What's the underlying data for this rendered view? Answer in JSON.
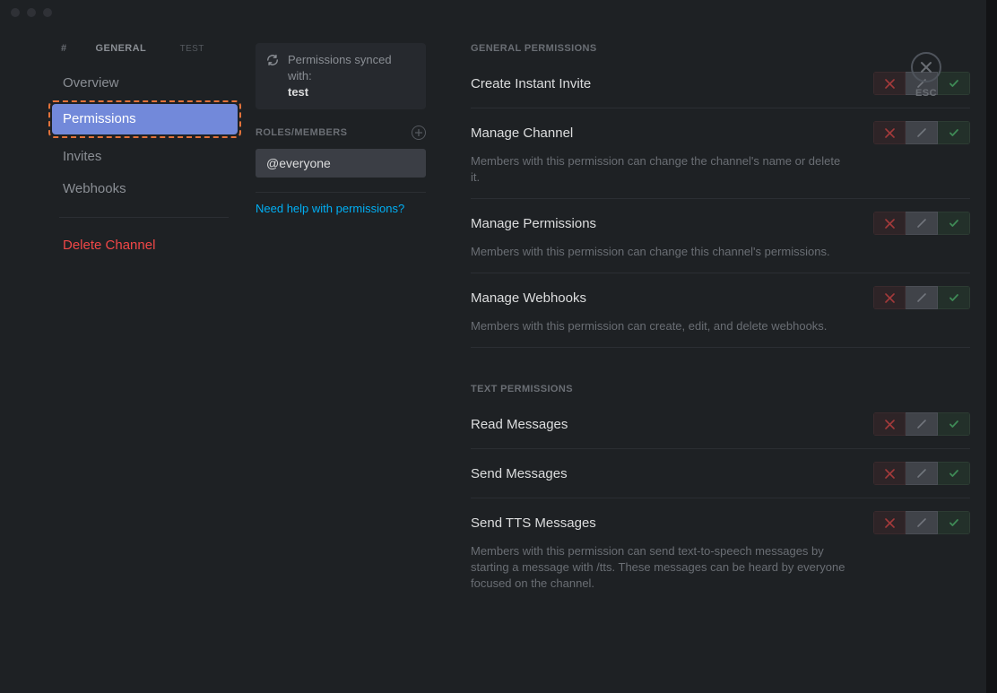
{
  "breadcrumb": {
    "hash": "#",
    "channel": "GENERAL",
    "server": "TEST"
  },
  "sidebar": {
    "items": [
      {
        "label": "Overview"
      },
      {
        "label": "Permissions"
      },
      {
        "label": "Invites"
      },
      {
        "label": "Webhooks"
      }
    ],
    "delete_label": "Delete Channel"
  },
  "sync": {
    "title": "Permissions synced with:",
    "subtitle": "test"
  },
  "roles": {
    "header": "Roles/Members",
    "selected": "@everyone"
  },
  "help_link": "Need help with permissions?",
  "close": {
    "esc": "ESC"
  },
  "sections": [
    {
      "title": "General Permissions",
      "perms": [
        {
          "name": "Create Instant Invite",
          "desc": ""
        },
        {
          "name": "Manage Channel",
          "desc": "Members with this permission can change the channel's name or delete it."
        },
        {
          "name": "Manage Permissions",
          "desc": "Members with this permission can change this channel's permissions."
        },
        {
          "name": "Manage Webhooks",
          "desc": "Members with this permission can create, edit, and delete webhooks."
        }
      ]
    },
    {
      "title": "Text Permissions",
      "perms": [
        {
          "name": "Read Messages",
          "desc": ""
        },
        {
          "name": "Send Messages",
          "desc": ""
        },
        {
          "name": "Send TTS Messages",
          "desc": "Members with this permission can send text-to-speech messages by starting a message with /tts. These messages can be heard by everyone focused on the channel."
        }
      ]
    }
  ]
}
